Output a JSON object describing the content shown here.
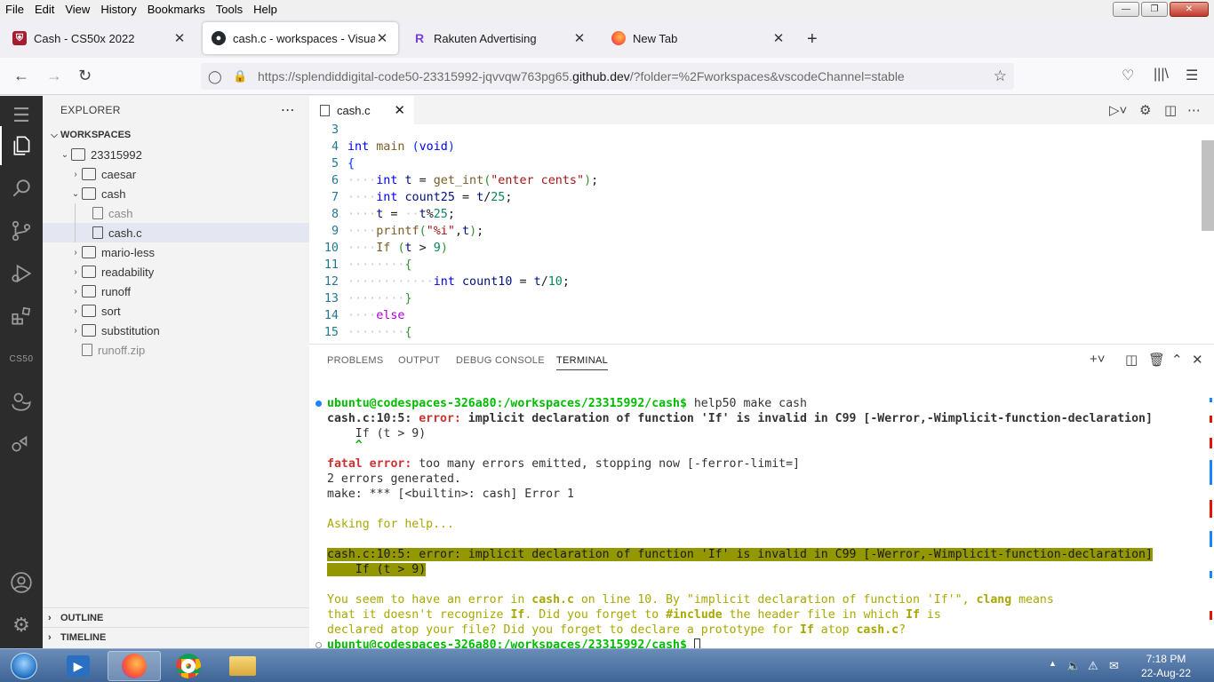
{
  "menubar": {
    "items": [
      "File",
      "Edit",
      "View",
      "History",
      "Bookmarks",
      "Tools",
      "Help"
    ]
  },
  "tabs": [
    {
      "title": "Cash - CS50x 2022",
      "icon": "harvard-shield-icon"
    },
    {
      "title": "cash.c - workspaces - Visual Stu",
      "icon": "github-icon"
    },
    {
      "title": "Rakuten Advertising",
      "icon": "rakuten-r-icon"
    },
    {
      "title": "New Tab",
      "icon": "firefox-icon"
    }
  ],
  "navbar": {
    "url_prefix": "https://splendiddigital-code50-23315992-jqvvqw763pg65.",
    "url_domain": "github.dev",
    "url_suffix": "/?folder=%2Fworkspaces&vscodeChannel=stable"
  },
  "sidebar": {
    "title": "EXPLORER",
    "root": "WORKSPACES",
    "items": [
      {
        "label": "23315992"
      },
      {
        "label": "caesar"
      },
      {
        "label": "cash"
      },
      {
        "label": "cash"
      },
      {
        "label": "cash.c"
      },
      {
        "label": "mario-less"
      },
      {
        "label": "readability"
      },
      {
        "label": "runoff"
      },
      {
        "label": "sort"
      },
      {
        "label": "substitution"
      },
      {
        "label": "runoff.zip"
      }
    ],
    "outline": "OUTLINE",
    "timeline": "TIMELINE",
    "cs50": "CS50"
  },
  "editor": {
    "tab": "cash.c",
    "lines": [
      {
        "n": "3"
      },
      {
        "n": "4"
      },
      {
        "n": "5"
      },
      {
        "n": "6"
      },
      {
        "n": "7"
      },
      {
        "n": "8"
      },
      {
        "n": "9"
      },
      {
        "n": "10"
      },
      {
        "n": "11"
      },
      {
        "n": "12"
      },
      {
        "n": "13"
      },
      {
        "n": "14"
      },
      {
        "n": "15"
      }
    ]
  },
  "panel": {
    "tabs": [
      "PROBLEMS",
      "OUTPUT",
      "DEBUG CONSOLE",
      "TERMINAL"
    ],
    "prompt": "ubuntu@codespaces-326a80:/workspaces/23315992/cash$",
    "cmd1": " help50 make cash",
    "err_loc": "cash.c:10:5: ",
    "err_word": "error:",
    "err_msg": " implicit declaration of function 'If' is invalid in C99 [-Werror,-Wimplicit-function-declaration]",
    "err_code": "    If (t > 9)",
    "caret": "    ^",
    "fatal_word": "fatal error:",
    "fatal_msg": " too many errors emitted, stopping now [-ferror-limit=]",
    "errors_generated": "2 errors generated.",
    "make_err": "make: *** [<builtin>: cash] Error 1",
    "asking": "Asking for help...",
    "hl_line1": "cash.c:10:5: error: implicit declaration of function 'If' is invalid in C99 [-Werror,-Wimplicit-function-declaration]",
    "hl_line2": "    If (t > 9)",
    "help1a": "You seem to have an error in ",
    "help1b": "cash.c",
    "help1c": " on line 10. By \"implicit declaration of function 'If'\", ",
    "help1d": "clang",
    "help1e": " means",
    "help2a": "that it doesn't recognize ",
    "help2b": "If",
    "help2c": ". Did you forget to ",
    "help2d": "#include",
    "help2e": " the header file in which ",
    "help2f": "If",
    "help2g": " is",
    "help3a": "declared atop your file? Did you forget to declare a prototype for ",
    "help3b": "If",
    "help3c": " atop ",
    "help3d": "cash.c",
    "help3e": "?"
  },
  "taskbar": {
    "time": "7:18 PM",
    "date": "22-Aug-22"
  }
}
